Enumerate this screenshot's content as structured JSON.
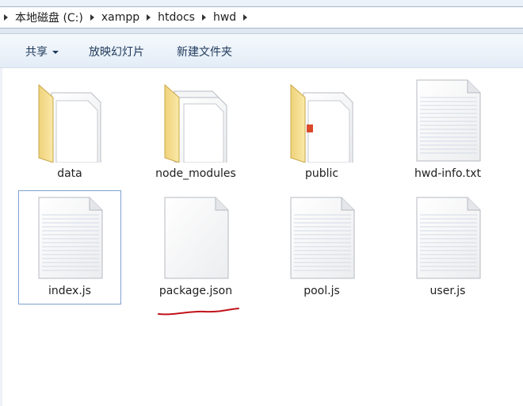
{
  "address": {
    "crumbs": [
      "本地磁盘 (C:)",
      "xampp",
      "htdocs",
      "hwd"
    ]
  },
  "toolbar": {
    "share_label": "共享",
    "slideshow_label": "放映幻灯片",
    "new_folder_label": "新建文件夹"
  },
  "files": [
    {
      "name": "data",
      "kind": "folder"
    },
    {
      "name": "node_modules",
      "kind": "folder"
    },
    {
      "name": "public",
      "kind": "folder"
    },
    {
      "name": "hwd-info.txt",
      "kind": "text"
    },
    {
      "name": "index.js",
      "kind": "text",
      "selected": true
    },
    {
      "name": "package.json",
      "kind": "blank"
    },
    {
      "name": "pool.js",
      "kind": "text"
    },
    {
      "name": "user.js",
      "kind": "text"
    }
  ],
  "colors": {
    "folder": "#f2d77a",
    "selection_border": "#7da2ce",
    "annotation_underline": "#c0141a"
  }
}
